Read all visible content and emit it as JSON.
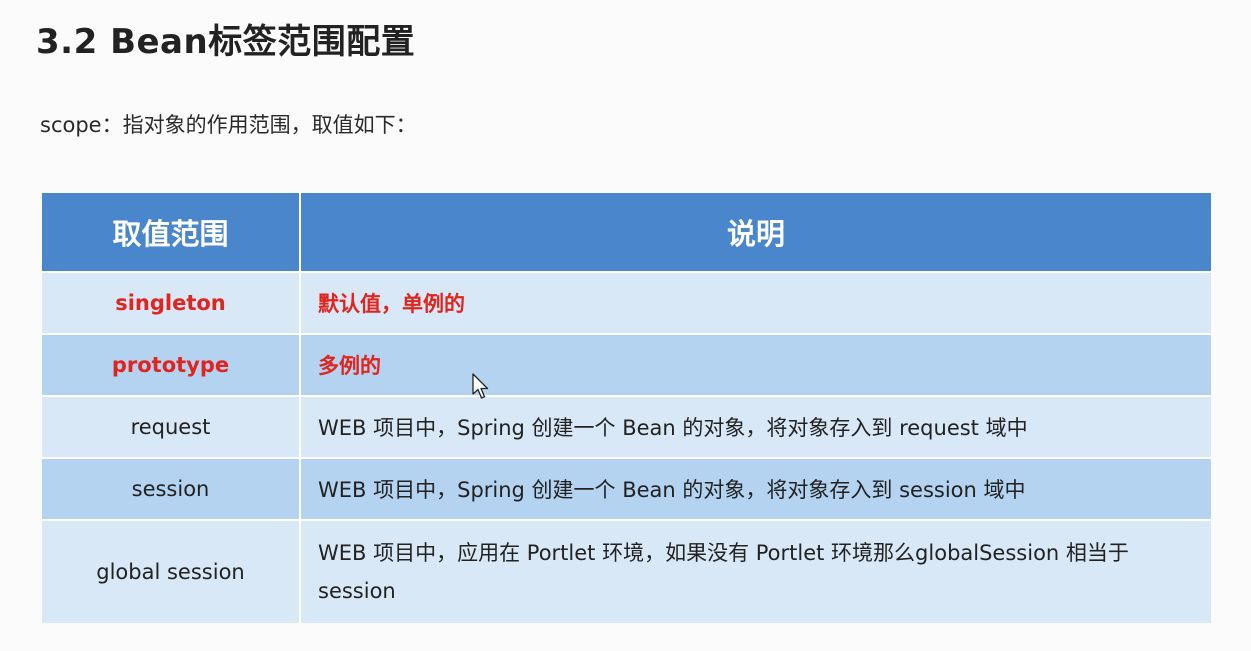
{
  "title": "3.2 Bean标签范围配置",
  "intro": "scope：指对象的作用范围，取值如下：",
  "table": {
    "headers": [
      "取值范围",
      "说明"
    ],
    "rows": [
      {
        "scope": "singleton",
        "desc": "默认值，单例的"
      },
      {
        "scope": "prototype",
        "desc": "多例的"
      },
      {
        "scope": "request",
        "desc": "WEB 项目中，Spring 创建一个 Bean 的对象，将对象存入到 request 域中"
      },
      {
        "scope": "session",
        "desc": "WEB 项目中，Spring 创建一个 Bean 的对象，将对象存入到 session 域中"
      },
      {
        "scope": "global session",
        "desc": "WEB 项目中，应用在 Portlet 环境，如果没有 Portlet 环境那么globalSession 相当于 session"
      }
    ]
  },
  "colors": {
    "header_bg": "#4a86cc",
    "row_light": "#d8e8f7",
    "row_dark": "#b3d3f1",
    "highlight_text": "#e0241e"
  },
  "icons": {
    "cursor": "mouse-pointer-icon"
  }
}
